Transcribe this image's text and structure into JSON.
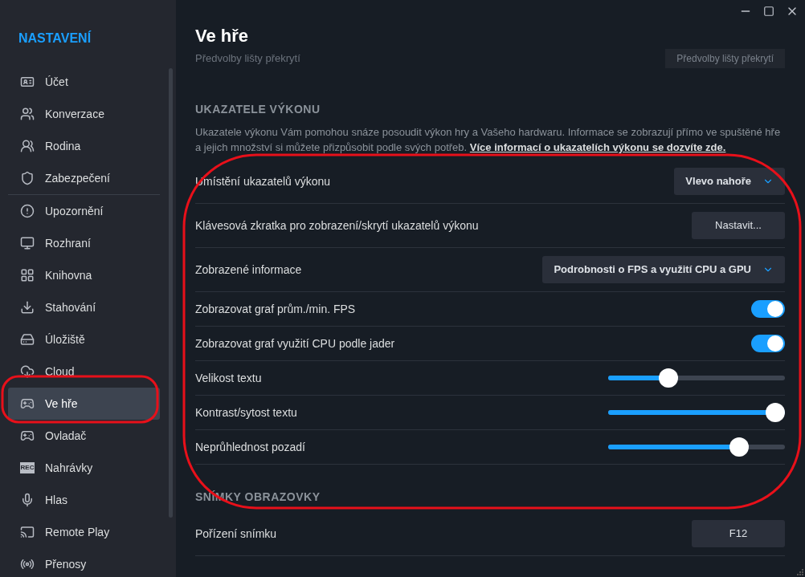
{
  "sidebar": {
    "title": "NASTAVENÍ",
    "groups": [
      [
        {
          "label": "Účet",
          "selected": false
        },
        {
          "label": "Konverzace",
          "selected": false
        },
        {
          "label": "Rodina",
          "selected": false
        },
        {
          "label": "Zabezpečení",
          "selected": false
        }
      ],
      [
        {
          "label": "Upozornění",
          "selected": false
        },
        {
          "label": "Rozhraní",
          "selected": false
        },
        {
          "label": "Knihovna",
          "selected": false
        },
        {
          "label": "Stahování",
          "selected": false
        },
        {
          "label": "Úložiště",
          "selected": false
        },
        {
          "label": "Cloud",
          "selected": false
        },
        {
          "label": "Ve hře",
          "selected": true
        },
        {
          "label": "Ovladač",
          "selected": false
        },
        {
          "label": "Nahrávky",
          "icon_label": "REC",
          "selected": false
        },
        {
          "label": "Hlas",
          "selected": false
        },
        {
          "label": "Remote Play",
          "selected": false
        },
        {
          "label": "Přenosy",
          "selected": false
        }
      ]
    ]
  },
  "page_title": "Ve hře",
  "faded_row": {
    "label": "Předvolby lišty překrytí",
    "button": "Předvolby lišty překrytí"
  },
  "sections": [
    {
      "title": "UKAZATELE VÝKONU",
      "description": "Ukazatele výkonu Vám pomohou snáze posoudit výkon hry a Vašeho hardwaru. Informace se zobrazují přímo ve spuštěné hře a jejich množství si můžete přizpůsobit podle svých potřeb.",
      "link": "Více informací o ukazatelích výkonu se dozvíte zde.",
      "rows": [
        {
          "kind": "dropdown",
          "label": "Umístění ukazatelů výkonu",
          "value": "Vlevo nahoře"
        },
        {
          "kind": "button",
          "label": "Klávesová zkratka pro zobrazení/skrytí ukazatelů výkonu",
          "value": "Nastavit..."
        },
        {
          "kind": "dropdown",
          "label": "Zobrazené informace",
          "value": "Podrobnosti o FPS a využití CPU a GPU"
        },
        {
          "kind": "toggle",
          "label": "Zobrazovat graf prům./min. FPS",
          "on": true
        },
        {
          "kind": "toggle",
          "label": "Zobrazovat graf využití CPU podle jader",
          "on": true
        },
        {
          "kind": "slider",
          "label": "Velikost textu",
          "level": 0.32
        },
        {
          "kind": "slider",
          "label": "Kontrast/sytost textu",
          "level": 1.0
        },
        {
          "kind": "slider",
          "label": "Neprůhlednost pozadí",
          "level": 0.77
        }
      ]
    },
    {
      "title": "SNÍMKY OBRAZOVKY",
      "rows": [
        {
          "kind": "button",
          "label": "Pořízení snímku",
          "value": "F12"
        }
      ]
    }
  ]
}
